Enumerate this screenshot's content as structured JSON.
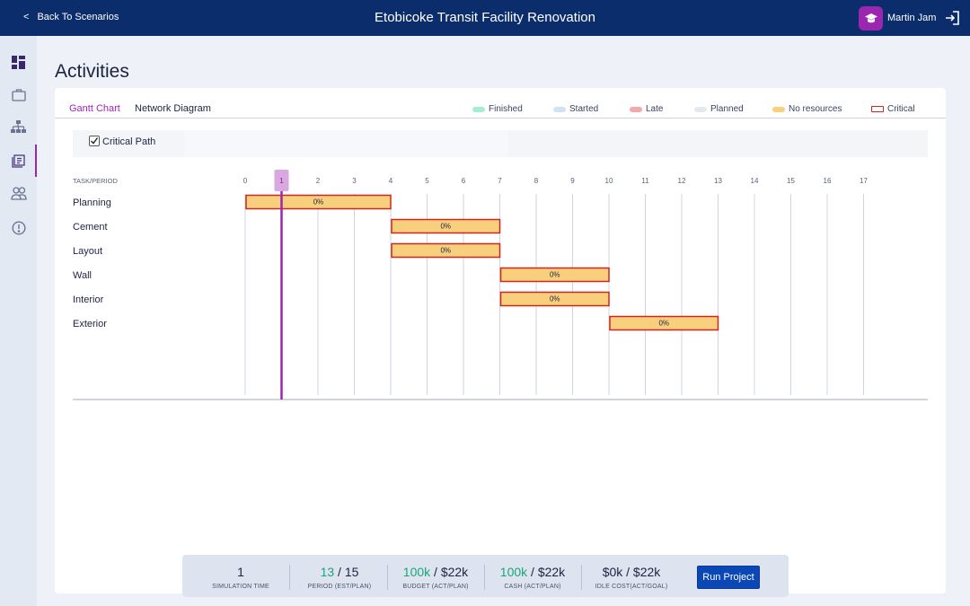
{
  "header": {
    "back_label": "Back To Scenarios",
    "title": "Etobicoke Transit Facility Renovation",
    "user_name": "Martin Jam",
    "avatar_icon": "graduation-cap-icon",
    "logout_icon": "logout-icon"
  },
  "sidebar": {
    "items": [
      {
        "icon": "dashboard-icon",
        "active": false
      },
      {
        "icon": "briefcase-icon",
        "active": false
      },
      {
        "icon": "hierarchy-icon",
        "active": false
      },
      {
        "icon": "activities-icon",
        "active": true
      },
      {
        "icon": "team-icon",
        "active": false
      },
      {
        "icon": "alert-icon",
        "active": false
      }
    ]
  },
  "page": {
    "title": "Activities"
  },
  "tabs": {
    "gantt": "Gantt Chart",
    "network": "Network Diagram",
    "active": "Gantt Chart"
  },
  "legend": [
    {
      "label": "Finished",
      "color": "#a6ecd6"
    },
    {
      "label": "Started",
      "color": "#cfe3f7"
    },
    {
      "label": "Late",
      "color": "#f3a9a9"
    },
    {
      "label": "Planned",
      "color": "#e4e9f0"
    },
    {
      "label": "No resources",
      "color": "#f8cf7c"
    },
    {
      "label": "Critical",
      "color": "#d0261d"
    }
  ],
  "filter": {
    "critical_path_label": "Critical Path",
    "critical_path_checked": true
  },
  "gantt": {
    "header_label": "TASK/PERIOD",
    "periods": [
      "0",
      "1",
      "2",
      "3",
      "4",
      "5",
      "6",
      "7",
      "8",
      "9",
      "10",
      "11",
      "12",
      "13",
      "14",
      "15",
      "16",
      "17"
    ],
    "current_period": 1,
    "bar_fill": "#f8cf7c",
    "bar_border": "#d0261d",
    "current_color": "#9b27b0",
    "tasks": [
      {
        "name": "Planning",
        "start": 0,
        "end": 4,
        "progress": "0%",
        "critical": true
      },
      {
        "name": "Cement",
        "start": 4,
        "end": 7,
        "progress": "0%",
        "critical": true
      },
      {
        "name": "Layout",
        "start": 4,
        "end": 7,
        "progress": "0%",
        "critical": true
      },
      {
        "name": "Wall",
        "start": 7,
        "end": 10,
        "progress": "0%",
        "critical": true
      },
      {
        "name": "Interior",
        "start": 7,
        "end": 10,
        "progress": "0%",
        "critical": true
      },
      {
        "name": "Exterior",
        "start": 10,
        "end": 13,
        "progress": "0%",
        "critical": true
      }
    ]
  },
  "stats": {
    "sim_time": {
      "value": "1",
      "label": "SIMULATION TIME"
    },
    "period": {
      "highlight": "13",
      "rest": " / 15",
      "label": "PERIOD (EST/PLAN)"
    },
    "budget": {
      "highlight": "100k",
      "rest": " / $22k",
      "label": "BUDGET (ACT/PLAN)"
    },
    "cash": {
      "highlight": "100k",
      "rest": " / $22k",
      "label": "CASH (ACT/PLAN)"
    },
    "idle": {
      "value": "$0k / $22k",
      "label": "IDLE COST(ACT/GOAL)"
    },
    "run_label": "Run Project"
  }
}
